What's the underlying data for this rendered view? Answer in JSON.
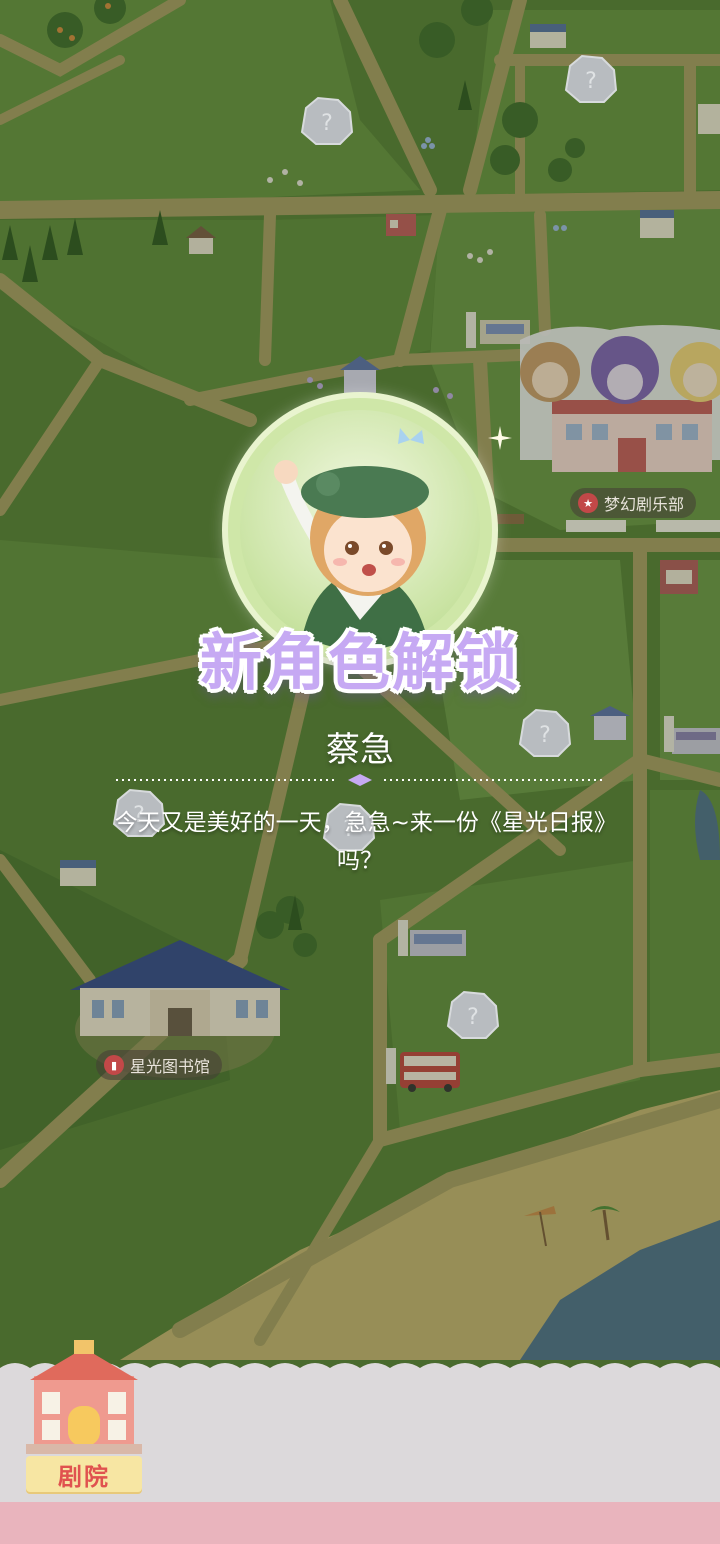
{
  "map": {
    "locations": [
      {
        "id": "dream-club",
        "label": "梦幻剧乐部"
      },
      {
        "id": "library",
        "label": "星光图书馆"
      }
    ],
    "locked_marker": "?"
  },
  "unlock_popup": {
    "title": "新角色解锁",
    "character_name": "蔡急",
    "quote": "今天又是美好的一天，急急~来一份《星光日报》吗？"
  },
  "bottom_panel": {
    "theater_tab": {
      "label": "剧院",
      "icon": "theater-building-icon"
    }
  },
  "colors": {
    "grass": "#567f35",
    "grass_light": "#6b9245",
    "road": "#a59a61",
    "sand": "#c3b06f",
    "water": "#4e6f8a",
    "title_purple": "#c6a9f3",
    "theater_label_text": "#e0524f"
  }
}
